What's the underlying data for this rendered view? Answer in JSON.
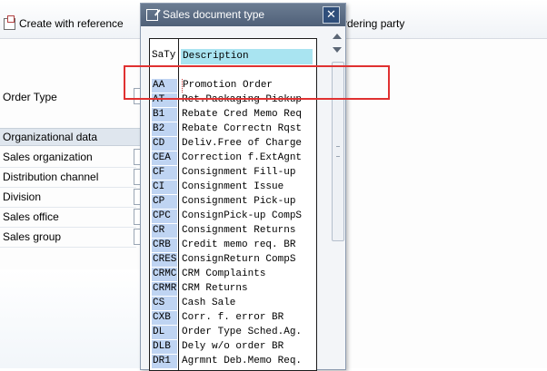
{
  "background": {
    "toolbar": {
      "create_with_reference": "Create with reference",
      "ordering_party": "rdering party"
    },
    "fields": {
      "order_type": "Order Type",
      "section_header": "Organizational data",
      "sales_organization": "Sales organization",
      "distribution_channel": "Distribution channel",
      "division": "Division",
      "sales_office": "Sales office",
      "sales_group": "Sales group"
    }
  },
  "dialog": {
    "title": "Sales document type",
    "close_glyph": "✕",
    "columns": {
      "key": "SaTy",
      "description": "Description"
    },
    "rows": [
      {
        "key": "AA",
        "description": "Promotion Order"
      },
      {
        "key": "AT",
        "description": "Ret.Packaging Pickup"
      },
      {
        "key": "B1",
        "description": "Rebate Cred Memo Req"
      },
      {
        "key": "B2",
        "description": "Rebate Correctn Rqst"
      },
      {
        "key": "CD",
        "description": "Deliv.Free of Charge"
      },
      {
        "key": "CEA",
        "description": "Correction f.ExtAgnt"
      },
      {
        "key": "CF",
        "description": "Consignment Fill-up"
      },
      {
        "key": "CI",
        "description": "Consignment Issue"
      },
      {
        "key": "CP",
        "description": "Consignment Pick-up"
      },
      {
        "key": "CPC",
        "description": "ConsignPick-up CompS"
      },
      {
        "key": "CR",
        "description": "Consignment Returns"
      },
      {
        "key": "CRB",
        "description": "Credit memo req. BR"
      },
      {
        "key": "CRES",
        "description": "ConsignReturn CompS"
      },
      {
        "key": "CRMC",
        "description": "CRM Complaints"
      },
      {
        "key": "CRMR",
        "description": "CRM Returns"
      },
      {
        "key": "CS",
        "description": "Cash Sale"
      },
      {
        "key": "CXB",
        "description": "Corr. f. error BR"
      },
      {
        "key": "DL",
        "description": "Order Type Sched.Ag."
      },
      {
        "key": "DLB",
        "description": "Dely w/o order BR"
      },
      {
        "key": "DR1",
        "description": "Agrmnt Deb.Memo Req."
      }
    ]
  },
  "colors": {
    "title_bar": "#4f6078",
    "header_highlight": "#a9e4f1",
    "key_cell": "#bfd4f2",
    "annotation": "#e03131"
  }
}
